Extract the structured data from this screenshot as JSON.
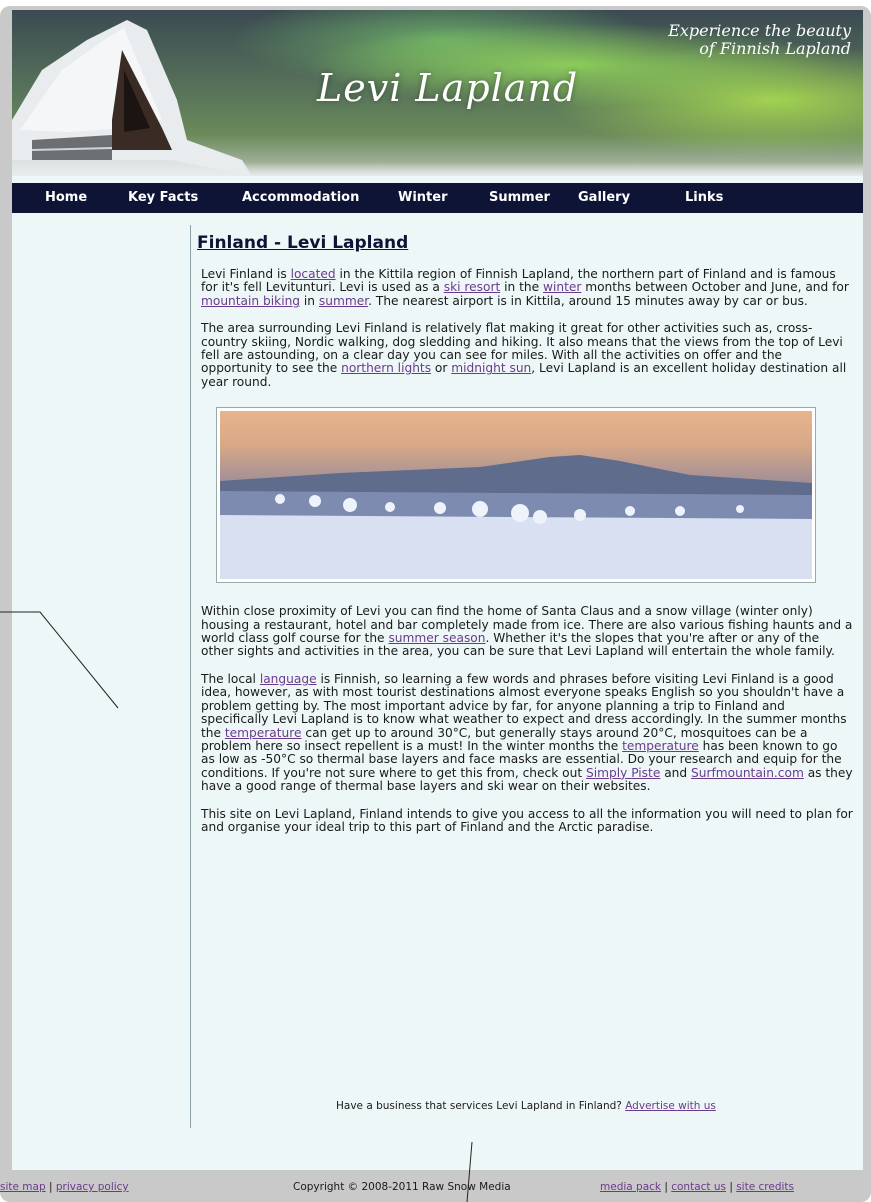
{
  "header": {
    "logo_text": "Levi Lapland",
    "slogan_line1": "Experience the beauty",
    "slogan_line2": "of Finnish Lapland"
  },
  "nav": {
    "items": [
      "Home",
      "Key Facts",
      "Accommodation",
      "Winter",
      "Summer",
      "Gallery",
      "Links"
    ]
  },
  "main": {
    "title": "Finland - Levi Lapland",
    "p1": {
      "t1": "Levi Finland is ",
      "l1": "located",
      "t2": " in the Kittila region of Finnish Lapland, the northern part of Finland and is famous for it's fell Levitunturi. Levi is used as a ",
      "l2": "ski resort",
      "t3": " in the ",
      "l3": "winter",
      "t4": " months between October and June, and for ",
      "l4": "mountain biking",
      "t5": " in ",
      "l5": "summer",
      "t6": ". The nearest airport is in Kittila, around 15 minutes away by car or bus."
    },
    "p2": {
      "t1": "The area surrounding Levi Finland is relatively flat making it great for other activities such as, cross-country skiing, Nordic walking, dog sledding and hiking. It also means that the views from the top of Levi fell are astounding, on a clear day you can see for miles. With all the activities on offer and the opportunity to see the ",
      "l1": "northern lights",
      "t2": " or ",
      "l2": "midnight sun",
      "t3": ", Levi Lapland is an excellent holiday destination all year round."
    },
    "p3": {
      "t1": "Within close proximity of Levi you can find the home of Santa Claus and a snow village (winter only) housing a restaurant, hotel and bar completely made from ice. There are also various fishing haunts and a world class golf course for the ",
      "l1": "summer season",
      "t2": ". Whether it's the slopes that you're after or any of the other sights and activities in the area, you can be sure that Levi Lapland will entertain the whole family."
    },
    "p4": {
      "t1": "The local ",
      "l1": "language",
      "t2": " is Finnish, so learning a few words and phrases before visiting Levi Finland is a good idea, however, as with most tourist destinations almost everyone speaks English so you shouldn't have a problem getting by. The most important advice by far, for anyone planning a trip to Finland and specifically Levi Lapland is to know what weather to expect and dress accordingly. In the summer months the ",
      "l2": "temperature",
      "t3": " can get up to around 30°C, but generally stays around 20°C, mosquitoes can be a problem here so insect repellent is a must! In the winter months the ",
      "l3": "temperature",
      "t4": " has been known to go as low as -50°C so thermal base layers and face masks are essential. Do your research and equip for the conditions. If you're not sure where to get this from, check out ",
      "l4": "Simply Piste",
      "t5": " and ",
      "l5": "Surfmountain.com",
      "t6": " as they have a good range of thermal base layers and ski wear on their websites."
    },
    "p5": "This site on Levi Lapland, Finland intends to give you access to all the information you will need to plan for and organise your ideal trip to this part of Finland and the Arctic paradise.",
    "ad_text": "Have a business that services Levi Lapland in Finland? ",
    "ad_link": "Advertise with us"
  },
  "footer": {
    "site_map": "site map",
    "privacy": "privacy policy",
    "sep": " | ",
    "copyright": "Copyright © 2008-2011 Raw Snow Media",
    "media_pack": "media pack",
    "contact": "contact us",
    "credits": "site credits"
  },
  "colors": {
    "nav_bg": "#0d1436",
    "link": "#6a3b8c",
    "page_bg": "#eef7f8"
  }
}
